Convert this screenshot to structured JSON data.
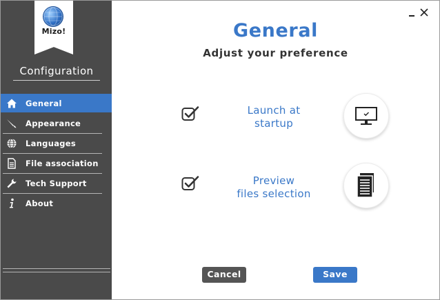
{
  "logo": {
    "text": "Mizo!"
  },
  "sidebar": {
    "title": "Configuration",
    "items": [
      {
        "label": "General",
        "icon": "home-icon",
        "active": true
      },
      {
        "label": "Appearance",
        "icon": "brush-icon",
        "active": false
      },
      {
        "label": "Languages",
        "icon": "globe-icon",
        "active": false
      },
      {
        "label": "File association",
        "icon": "document-icon",
        "active": false
      },
      {
        "label": "Tech Support",
        "icon": "wrench-icon",
        "active": false
      },
      {
        "label": "About",
        "icon": "info-icon",
        "active": false
      }
    ]
  },
  "header": {
    "title": "General",
    "subtitle": "Adjust your preference"
  },
  "options": [
    {
      "label_line1": "Launch at",
      "label_line2": "startup",
      "checked": true,
      "icon": "monitor-icon"
    },
    {
      "label_line1": "Preview",
      "label_line2": "files selection",
      "checked": true,
      "icon": "files-icon"
    }
  ],
  "buttons": {
    "cancel": "Cancel",
    "save": "Save"
  },
  "colors": {
    "accent": "#3a78c8",
    "sidebar_bg": "#4a4a4a",
    "cancel_bg": "#555555"
  }
}
